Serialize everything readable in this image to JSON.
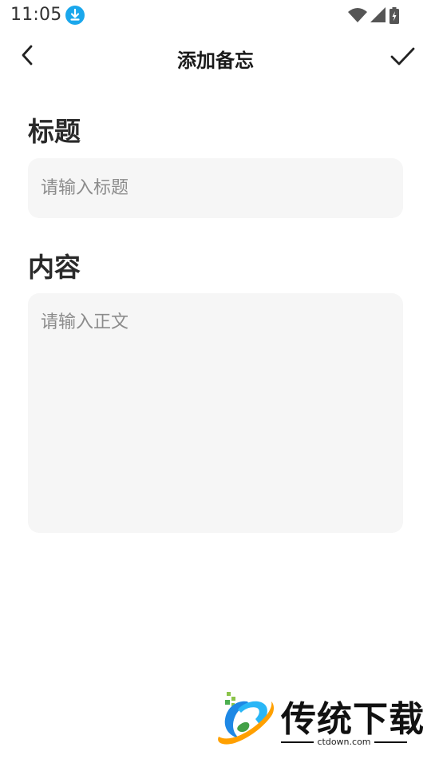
{
  "status_bar": {
    "time": "11:05",
    "icons": [
      "download-icon",
      "wifi-icon",
      "signal-icon",
      "battery-charging-icon"
    ],
    "download_icon_color": "#1AA7EC"
  },
  "header": {
    "title": "添加备忘",
    "back_icon": "chevron-left-icon",
    "confirm_icon": "checkmark-icon"
  },
  "form": {
    "title_label": "标题",
    "title_placeholder": "请输入标题",
    "title_value": "",
    "content_label": "内容",
    "content_placeholder": "请输入正文",
    "content_value": ""
  },
  "watermark": {
    "brand": "传统下载",
    "url": "ctdown.com"
  },
  "colors": {
    "background": "#FFFFFF",
    "input_background": "#F6F6F6",
    "text": "#222222",
    "placeholder": "#8C8C8C"
  }
}
